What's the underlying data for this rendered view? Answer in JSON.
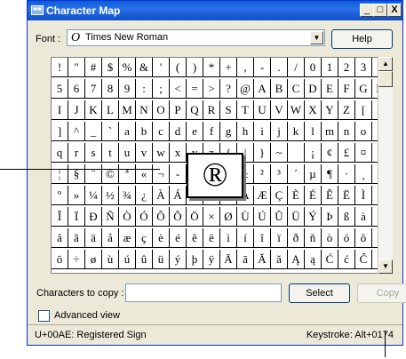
{
  "window": {
    "title": "Character Map",
    "minimize": "_",
    "maximize": "□",
    "close": "X"
  },
  "font_row": {
    "label": "Font :",
    "glyph": "O",
    "value": "Times New Roman",
    "help_label": "Help"
  },
  "grid": {
    "rows": [
      [
        "!",
        "\"",
        "#",
        "$",
        "%",
        "&",
        "'",
        "(",
        ")",
        "*",
        "+",
        ",",
        "-",
        ".",
        "/",
        "0",
        "1",
        "2",
        "3",
        "4"
      ],
      [
        "5",
        "6",
        "7",
        "8",
        "9",
        ":",
        ";",
        "<",
        "=",
        ">",
        "?",
        "@",
        "A",
        "B",
        "C",
        "D",
        "E",
        "F",
        "G",
        "H"
      ],
      [
        "I",
        "J",
        "K",
        "L",
        "M",
        "N",
        "O",
        "P",
        "Q",
        "R",
        "S",
        "T",
        "U",
        "V",
        "W",
        "X",
        "Y",
        "Z",
        "[",
        "\\"
      ],
      [
        "]",
        "^",
        "_",
        "`",
        "a",
        "b",
        "c",
        "d",
        "e",
        "f",
        "g",
        "h",
        "i",
        "j",
        "k",
        "l",
        "m",
        "n",
        "o",
        "p"
      ],
      [
        "q",
        "r",
        "s",
        "t",
        "u",
        "v",
        "w",
        "x",
        "y",
        "z",
        "{",
        "|",
        "}",
        "~",
        "",
        "¡",
        "¢",
        "£",
        "¤",
        "¥"
      ],
      [
        "¦",
        "§",
        "¨",
        "©",
        "ª",
        "«",
        "¬",
        "-",
        "®",
        "¯",
        "°",
        "±",
        "²",
        "³",
        "´",
        "µ",
        "¶",
        "·",
        "¸",
        "¹"
      ],
      [
        "º",
        "»",
        "¼",
        "½",
        "¾",
        "¿",
        "À",
        "Á",
        "Â",
        "Ã",
        "Ä",
        "Å",
        "Æ",
        "Ç",
        "È",
        "É",
        "Ê",
        "Ë",
        "Ì",
        "Í"
      ],
      [
        "Î",
        "Ï",
        "Ð",
        "Ñ",
        "Ò",
        "Ó",
        "Ô",
        "Õ",
        "Ö",
        "×",
        "Ø",
        "Ù",
        "Ú",
        "Û",
        "Ü",
        "Ý",
        "Þ",
        "ß",
        "à",
        "á"
      ],
      [
        "â",
        "ã",
        "ä",
        "å",
        "æ",
        "ç",
        "è",
        "é",
        "ê",
        "ë",
        "ì",
        "í",
        "î",
        "ï",
        "ð",
        "ñ",
        "ò",
        "ó",
        "ô",
        "õ"
      ],
      [
        "ö",
        "÷",
        "ø",
        "ù",
        "ú",
        "û",
        "ü",
        "ý",
        "þ",
        "ÿ",
        "Ā",
        "ā",
        "Ă",
        "ă",
        "Ą",
        "ą",
        "Ć",
        "ć",
        "Ĉ",
        "ĉ"
      ]
    ],
    "zoomed_char": "®"
  },
  "copy_row": {
    "label": "Characters to copy :",
    "value": "",
    "select_label": "Select",
    "copy_label": "Copy"
  },
  "advanced": {
    "label": "Advanced view",
    "checked": false
  },
  "status": {
    "left": "U+00AE: Registered Sign",
    "right": "Keystroke: Alt+0174"
  },
  "colors": {
    "titlebar": "#0a5fd8",
    "window": "#ece9d8"
  }
}
